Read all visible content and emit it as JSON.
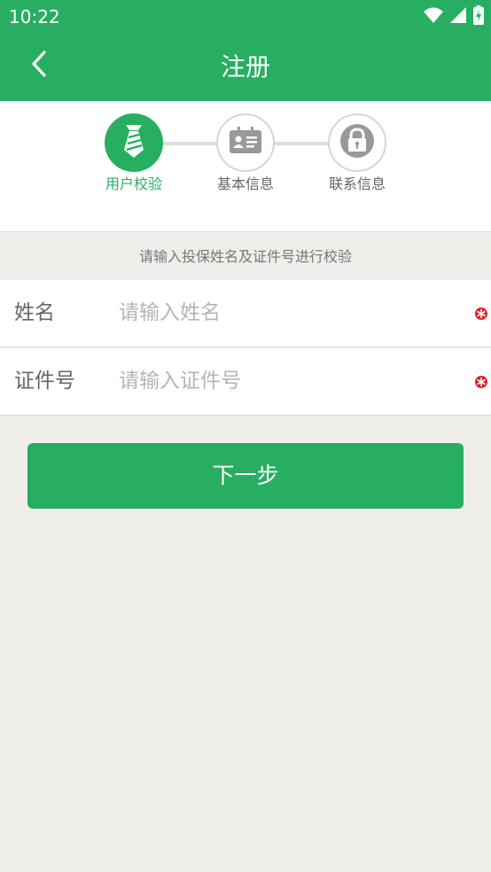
{
  "status_bar": {
    "time": "10:22",
    "icons": [
      "wifi-icon",
      "signal-icon",
      "battery-charging-icon"
    ]
  },
  "header": {
    "title": "注册",
    "back_icon": "chevron-left-icon"
  },
  "steps": [
    {
      "label": "用户校验",
      "icon": "tie-icon",
      "active": true
    },
    {
      "label": "基本信息",
      "icon": "id-card-icon",
      "active": false
    },
    {
      "label": "联系信息",
      "icon": "lock-icon",
      "active": false
    }
  ],
  "hint": "请输入投保姓名及证件号进行校验",
  "form": {
    "name": {
      "label": "姓名",
      "placeholder": "请输入姓名",
      "value": ""
    },
    "id_number": {
      "label": "证件号",
      "placeholder": "请输入证件号",
      "value": ""
    }
  },
  "next_button": {
    "label": "下一步"
  },
  "colors": {
    "primary": "#27AE60",
    "background": "#EFEEEB",
    "required": "#E0202F",
    "inactive_step": "#999999"
  }
}
